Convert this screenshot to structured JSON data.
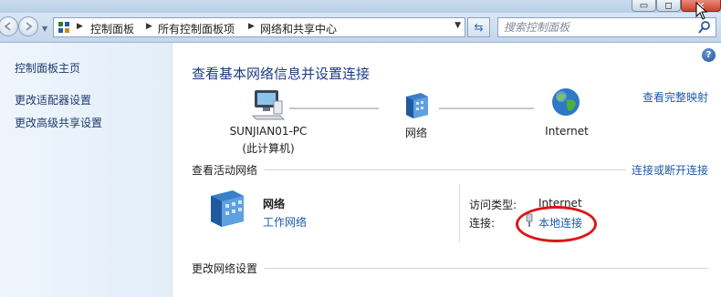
{
  "window": {
    "minimize_glyph": "▭",
    "maximize_glyph": "◻",
    "close_glyph": "✕"
  },
  "nav": {
    "back_icon": "arrow-left-icon",
    "forward_icon": "arrow-right-icon",
    "breadcrumbs": [
      "控制面板",
      "所有控制面板项",
      "网络和共享中心"
    ],
    "search_placeholder": "搜索控制面板"
  },
  "sidebar": {
    "items": [
      {
        "label": "控制面板主页"
      },
      {
        "label": "更改适配器设置"
      },
      {
        "label": "更改高级共享设置"
      }
    ]
  },
  "main": {
    "help": "?",
    "title": "查看基本网络信息并设置连接",
    "full_map_link": "查看完整映射",
    "map": {
      "computer_name": "SUNJIAN01-PC",
      "computer_sub": "(此计算机)",
      "network_label": "网络",
      "internet_label": "Internet"
    },
    "active_networks": {
      "title": "查看活动网络",
      "connect_link": "连接或断开连接",
      "network_name": "网络",
      "network_type": "工作网络",
      "access_type_label": "访问类型:",
      "access_type_value": "Internet",
      "connections_label": "连接:",
      "connections_value": "本地连接"
    },
    "change_settings_title": "更改网络设置"
  },
  "colors": {
    "link": "#1e5aa8",
    "title": "#1e3c82",
    "annotation": "#d81818"
  }
}
